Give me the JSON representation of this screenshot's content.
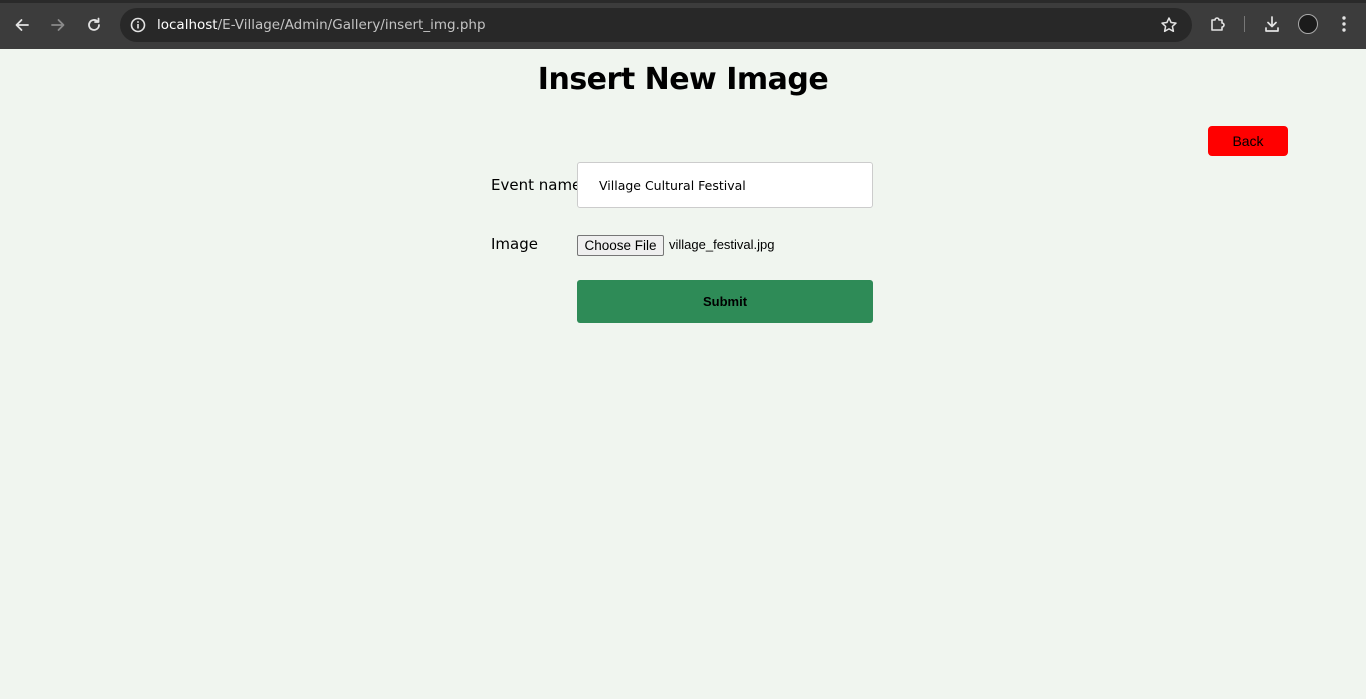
{
  "browser": {
    "url_host": "localhost",
    "url_path": "/E-Village/Admin/Gallery/insert_img.php",
    "icons": {
      "back": "back-arrow-icon",
      "forward": "forward-arrow-icon",
      "reload": "reload-icon",
      "site_info": "info-icon",
      "bookmark": "star-icon",
      "extensions": "puzzle-icon",
      "downloads": "download-icon",
      "profile": "avatar",
      "menu": "kebab-menu-icon"
    }
  },
  "page": {
    "title": "Insert New Image",
    "back_label": "Back",
    "back_color": "#ff0000",
    "background": "#f0f5ef"
  },
  "form": {
    "event_name_label": "Event name",
    "event_name_value": "Village Cultural Festival",
    "image_label": "Image",
    "file_button_label": "Choose File",
    "file_name": "village_festival.jpg",
    "submit_label": "Submit",
    "submit_color": "#2e8b57"
  }
}
